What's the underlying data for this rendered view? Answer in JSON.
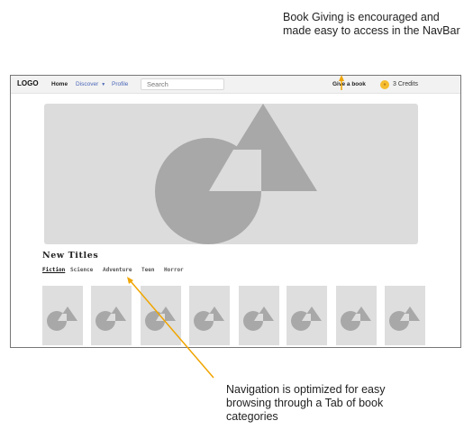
{
  "annotations": {
    "top": "Book Giving is encouraged and made easy to access in the NavBar",
    "bottom": "Navigation is optimized for easy browsing through a  Tab of book categories"
  },
  "navbar": {
    "logo": "LOGO",
    "home": "Home",
    "discover": "Discover",
    "profile": "Profile",
    "search_placeholder": "Search",
    "give_book": "Give a book",
    "credits": "3 Credits"
  },
  "main": {
    "section_title": "New Titles",
    "tabs": [
      {
        "label": "Fiction",
        "active": true
      },
      {
        "label": "Science",
        "active": false
      },
      {
        "label": "Adventure",
        "active": false
      },
      {
        "label": "Teen",
        "active": false
      },
      {
        "label": "Horror",
        "active": false
      }
    ],
    "book_count": 8
  },
  "colors": {
    "accent_arrow": "#f0a500",
    "coin": "#f5bd2e",
    "link": "#4a66b8",
    "placeholder_shape": "#a8a8a8",
    "placeholder_bg": "#dcdcdc"
  }
}
